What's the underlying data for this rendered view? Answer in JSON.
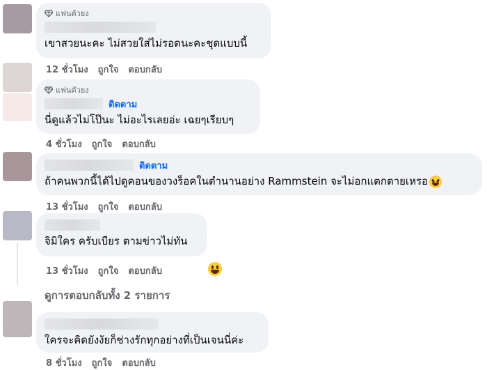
{
  "badge_label": "แฟนตัวยง",
  "follow_label": "ติดตาม",
  "comments": [
    {
      "text": "เขาสวยนะคะ ไม่สวยใส่ไม่รอดนะคะชุดแบบนี้",
      "time": "12 ชั่วโมง",
      "like": "ถูกใจ",
      "reply": "ตอบกลับ",
      "avatar_color": "#a89aa3"
    },
    {
      "text": "นี่ดูแล้วไม่โป๊นะ ไม่อะไรเลยอ่ะ เฉยๆเรียบๆ",
      "time": "4 ชั่วโมง",
      "like": "ถูกใจ",
      "reply": "ตอบกลับ",
      "avatar_color": "#e2d8d6"
    },
    {
      "text": "ถ้าคนพวกนี้ได้ไปดูคอนของวงร็อคในตำนานอย่าง Rammstein จะไม่อกแตกตายเหรอ",
      "time": "13 ชั่วโมง",
      "like": "ถูกใจ",
      "reply": "ตอบกลับ",
      "avatar_color": "#a7979b"
    },
    {
      "text": "จิมิใคร ครับเบียร ตามข่าวไม่ทัน",
      "time": "13 ชั่วโมง",
      "like": "ถูกใจ",
      "reply": "ตอบกลับ",
      "avatar_color": "#b9b8c6"
    },
    {
      "text": "ใครจะคิดยังงัยก็ช่างรักทุกอย่างที่เป็นเจนนี่ค่ะ",
      "time": "8 ชั่วโมง",
      "like": "ถูกใจ",
      "reply": "ตอบกลับ",
      "avatar_color": "#bfb6ba"
    }
  ],
  "view_replies": "ดูการตอบกลับทั้ง 2 รายการ",
  "icons": {
    "badge": "diamond-icon",
    "laugh": "laughing-emoji-icon",
    "grin": "grinning-emoji-icon"
  }
}
